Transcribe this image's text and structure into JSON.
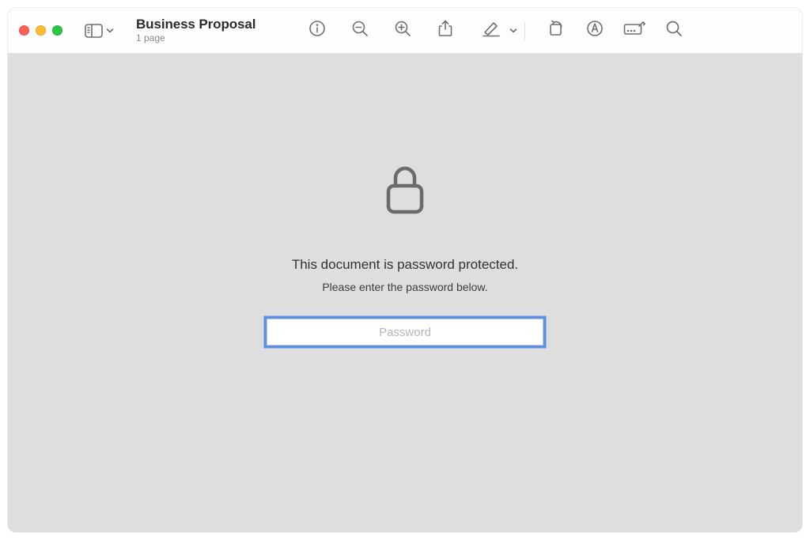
{
  "document": {
    "title": "Business Proposal",
    "subtitle": "1 page"
  },
  "protected": {
    "primary": "This document is password protected.",
    "secondary": "Please enter the password below.",
    "placeholder": "Password",
    "value": ""
  }
}
